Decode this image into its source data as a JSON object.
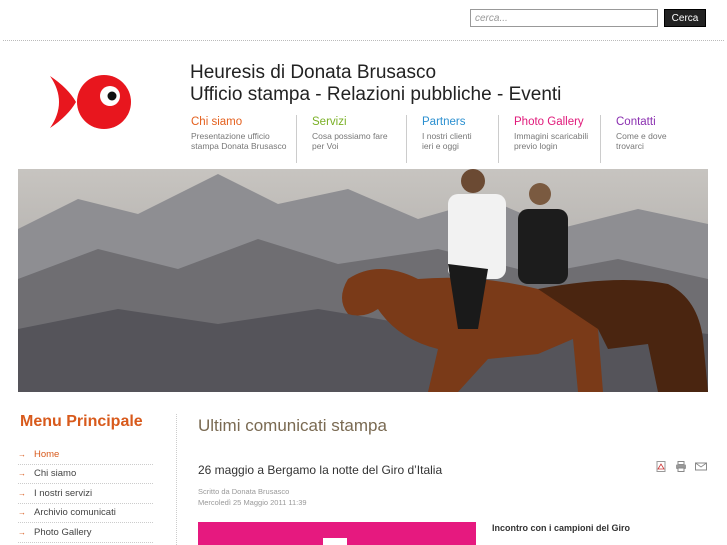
{
  "search": {
    "placeholder": "cerca...",
    "button_label": "Cerca"
  },
  "site": {
    "title_line1": "Heuresis di Donata Brusasco",
    "title_line2": "Ufficio stampa - Relazioni pubbliche - Eventi"
  },
  "nav": [
    {
      "label": "Chi siamo",
      "desc1": "Presentazione ufficio",
      "desc2": "stampa Donata Brusasco",
      "color": "#e4601e"
    },
    {
      "label": "Servizi",
      "desc1": "Cosa possiamo fare",
      "desc2": "per Voi",
      "color": "#7ab026"
    },
    {
      "label": "Partners",
      "desc1": "I nostri clienti",
      "desc2": "ieri e oggi",
      "color": "#2a8fd0"
    },
    {
      "label": "Photo Gallery",
      "desc1": "Immagini scaricabili",
      "desc2": "previo login",
      "color": "#e0197a"
    },
    {
      "label": "Contatti",
      "desc1": "Come e dove",
      "desc2": "trovarci",
      "color": "#8a2fb0"
    }
  ],
  "sidebar": {
    "title": "Menu Principale",
    "items": [
      "Home",
      "Chi siamo",
      "I nostri servizi",
      "Archivio comunicati",
      "Photo Gallery"
    ]
  },
  "main": {
    "title": "Ultimi comunicati stampa",
    "article": {
      "title": "26 maggio a Bergamo la notte del Giro d’Italia",
      "author": "Scritto da Donata Brusasco",
      "date": "Mercoledì 25 Maggio 2011 11:39",
      "lead": "Incontro con i campioni del Giro"
    }
  },
  "colors": {
    "accent": "#d85a1c",
    "logo_red": "#e8161e"
  }
}
